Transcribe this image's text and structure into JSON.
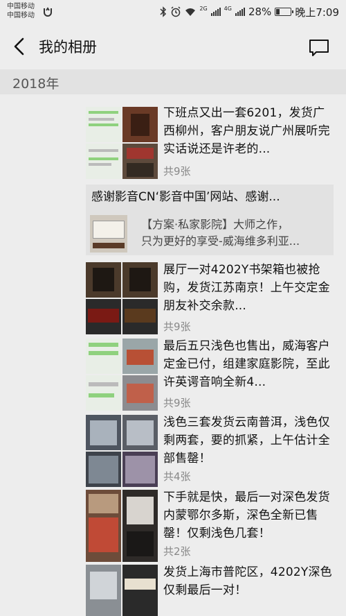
{
  "status_bar": {
    "carrier_1": "中国移动",
    "carrier_2": "中国移动",
    "signal_1": "2G",
    "signal_2": "4G",
    "battery_percent": "28%",
    "battery_level": 0.28,
    "time": "晚上7:09"
  },
  "header": {
    "title": "我的相册"
  },
  "year": "2018年",
  "posts": [
    {
      "text": "下班点又出一套6201，发货广西柳州，客户朋友说广州展听完实话说还是许老的...",
      "count": "共9张"
    },
    {
      "text": "展厅一对4202Y书架箱也被抢购，发货江苏南京！上午交定金朋友补交余款...",
      "count": "共9张"
    },
    {
      "text": "最后五只浅色也售出，威海客户定金已付，组建家庭影院，至此许英谔音响全新4...",
      "count": "共9张"
    },
    {
      "text": "浅色三套发货云南普洱，浅色仅剩两套，要的抓紧，上午估计全部售罄！",
      "count": "共4张"
    },
    {
      "text": "下手就是快，最后一对深色发货内蒙鄂尔多斯，深色全新已售罄！仅剩浅色几套！",
      "count": "共2张"
    },
    {
      "text": "发货上海市普陀区，4202Y深色仅剩最后一对！",
      "count": ""
    }
  ],
  "shared": {
    "title": "感谢影音CN‘影音中国’网站、感谢...",
    "desc_line1": "【方案·私家影院】大师之作，",
    "desc_line2": "只为更好的享受-威海维多利亚..."
  },
  "colors": {
    "background": "#ededed",
    "year_bar": "#e2e2e2",
    "share_card": "#e2e2e2",
    "count_text": "#888888"
  }
}
